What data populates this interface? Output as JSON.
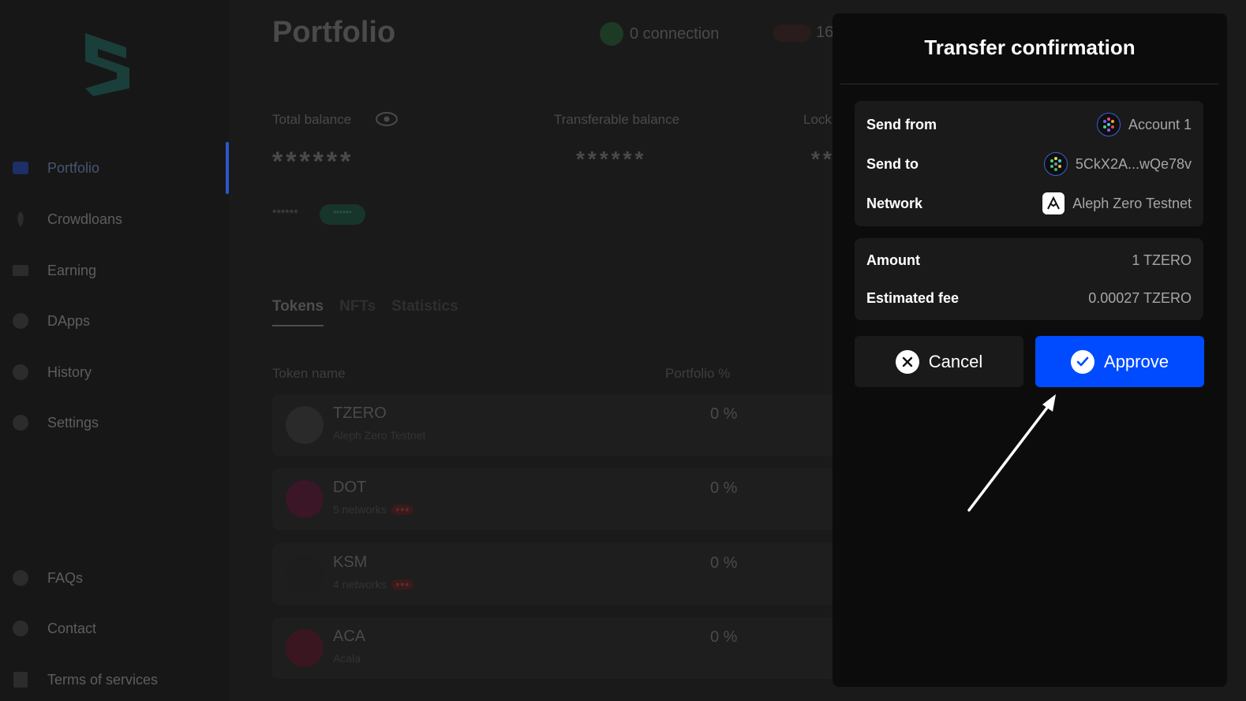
{
  "sidebar": {
    "items": [
      {
        "label": "Portfolio",
        "icon": "portfolio-icon"
      },
      {
        "label": "Crowdloans",
        "icon": "rocket-icon"
      },
      {
        "label": "Earning",
        "icon": "earning-icon"
      },
      {
        "label": "DApps",
        "icon": "globe-icon"
      },
      {
        "label": "History",
        "icon": "clock-icon"
      },
      {
        "label": "Settings",
        "icon": "gear-icon"
      }
    ],
    "footer_items": [
      {
        "label": "FAQs",
        "icon": "info-icon"
      },
      {
        "label": "Contact",
        "icon": "messenger-icon"
      },
      {
        "label": "Terms of services",
        "icon": "document-icon"
      }
    ]
  },
  "header": {
    "title": "Portfolio",
    "connection": "0 connection",
    "network_count": "16"
  },
  "balances": {
    "total_label": "Total balance",
    "total_value": "******",
    "transferable_label": "Transferable balance",
    "transferable_value": "******",
    "locked_label": "Lock",
    "locked_value": "**",
    "change_value": "******",
    "change_pill": "******"
  },
  "tabs": [
    "Tokens",
    "NFTs",
    "Statistics"
  ],
  "table": {
    "headers": {
      "name": "Token name",
      "pct": "Portfolio %"
    },
    "rows": [
      {
        "name": "TZERO",
        "sub": "Aleph Zero Testnet",
        "badge": "",
        "pct": "0 %"
      },
      {
        "name": "DOT",
        "sub": "5 networks",
        "badge": "",
        "pct": "0 %"
      },
      {
        "name": "KSM",
        "sub": "4 networks",
        "badge": "",
        "pct": "0 %"
      },
      {
        "name": "ACA",
        "sub": "Acala",
        "badge": "",
        "pct": "0 %"
      }
    ]
  },
  "modal": {
    "title": "Transfer confirmation",
    "send_from_label": "Send from",
    "send_from_value": "Account 1",
    "send_to_label": "Send to",
    "send_to_value": "5CkX2A...wQe78v",
    "network_label": "Network",
    "network_value": "Aleph Zero Testnet",
    "amount_label": "Amount",
    "amount_value": "1 TZERO",
    "fee_label": "Estimated fee",
    "fee_value": "0.00027 TZERO",
    "cancel_label": "Cancel",
    "approve_label": "Approve"
  },
  "colors": {
    "accent": "#004bff",
    "modal_bg": "#0c0c0c",
    "card_bg": "#1a1a1a"
  }
}
